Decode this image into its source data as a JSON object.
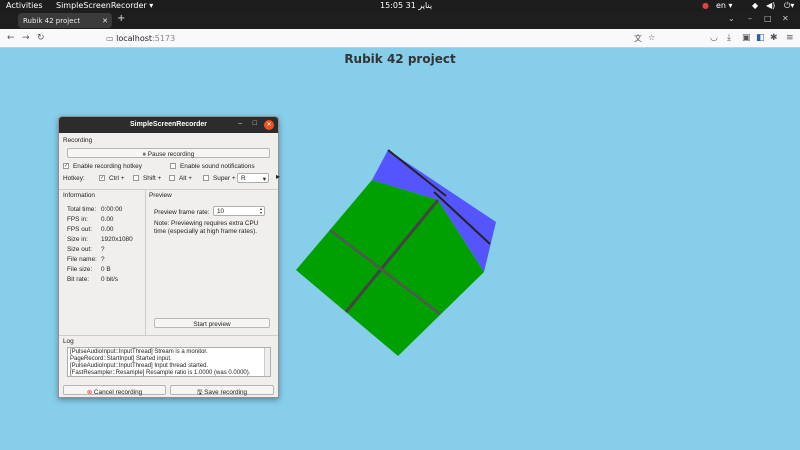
{
  "topbar": {
    "activities": "Activities",
    "app": "SimpleScreenRecorder ▾",
    "clock": "15:05  31 يناير",
    "lang": "en ▾"
  },
  "browser": {
    "tab_title": "Rubik 42 project",
    "url_host": "localhost",
    "url_port": ":5173"
  },
  "page": {
    "title": "Rubik 42 project"
  },
  "recorder": {
    "window_title": "SimpleScreenRecorder",
    "recording_section": "Recording",
    "pause_button": "Pause recording",
    "enable_hotkey_label": "Enable recording hotkey",
    "enable_hotkey_checked": true,
    "sound_notifications_label": "Enable sound notifications",
    "sound_notifications_checked": false,
    "hotkey_label": "Hotkey:",
    "ctrl_label": "Ctrl +",
    "ctrl_checked": true,
    "shift_label": "Shift +",
    "shift_checked": false,
    "alt_label": "Alt +",
    "alt_checked": false,
    "super_label": "Super +",
    "super_checked": false,
    "key_value": "R",
    "information_section": "Information",
    "info": [
      {
        "label": "Total time:",
        "value": "0:00:00"
      },
      {
        "label": "FPS in:",
        "value": "0.00"
      },
      {
        "label": "FPS out:",
        "value": "0.00"
      },
      {
        "label": "Size in:",
        "value": "1920x1080"
      },
      {
        "label": "Size out:",
        "value": "?"
      },
      {
        "label": "File name:",
        "value": "?"
      },
      {
        "label": "File size:",
        "value": "0 B"
      },
      {
        "label": "Bit rate:",
        "value": "0 bit/s"
      }
    ],
    "preview_section": "Preview",
    "preview_rate_label": "Preview frame rate:",
    "preview_rate_value": "10",
    "preview_note_1": "Note: Previewing requires extra CPU",
    "preview_note_2": "time (especially at high frame rates).",
    "start_preview_button": "Start preview",
    "log_section": "Log",
    "log_lines": [
      "[PulseAudioInput::InputThread] Stream is a monitor.",
      "PageRecord::StartInput] Started input.",
      "[PulseAudioInput::InputThread] Input thread started.",
      "[FastResampler::Resample] Resample ratio is 1.0000 (was 0.0000)."
    ],
    "cancel_button": "Cancel recording",
    "save_button": "Save recording"
  },
  "colors": {
    "background": "#87ceeb",
    "cube_green": "#00a000",
    "cube_blue": "#5555ff",
    "titlebar": "#2c2c2c",
    "close_orange": "#e95420"
  },
  "icons": [
    "dropdown-arrow-icon",
    "power-icon",
    "back-arrow-icon",
    "forward-arrow-icon",
    "reload-icon",
    "page-info-icon",
    "translate-icon",
    "bookmark-star-icon",
    "pocket-icon",
    "download-icon",
    "extensions-icon",
    "menu-icon",
    "pause-icon",
    "cancel-icon",
    "save-icon"
  ]
}
